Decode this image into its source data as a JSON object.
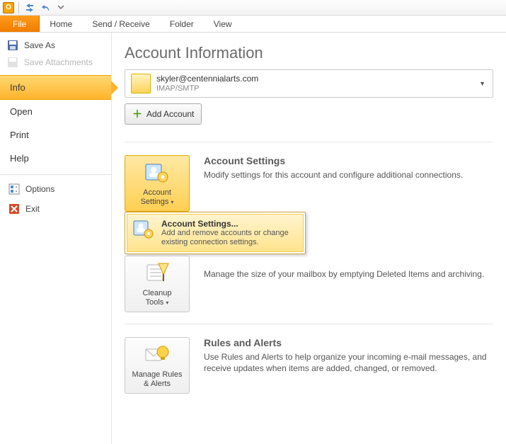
{
  "ribbon": {
    "file": "File",
    "tabs": [
      "Home",
      "Send / Receive",
      "Folder",
      "View"
    ]
  },
  "nav": {
    "save_as": "Save As",
    "save_attachments": "Save Attachments",
    "items": [
      "Info",
      "Open",
      "Print",
      "Help"
    ],
    "selected_index": 0,
    "options": "Options",
    "exit": "Exit"
  },
  "page": {
    "title": "Account Information",
    "account": {
      "email": "skyler@centennialarts.com",
      "protocol": "IMAP/SMTP"
    },
    "add_account": "Add Account",
    "sections": {
      "account_settings": {
        "button_line1": "Account",
        "button_line2": "Settings",
        "heading": "Account Settings",
        "body": "Modify settings for this account and configure additional connections.",
        "menu": {
          "title": "Account Settings...",
          "desc": "Add and remove accounts or change existing connection settings."
        }
      },
      "cleanup": {
        "button_line1": "Cleanup",
        "button_line2": "Tools",
        "body": "Manage the size of your mailbox by emptying Deleted Items and archiving."
      },
      "rules": {
        "button_line1": "Manage Rules",
        "button_line2": "& Alerts",
        "heading": "Rules and Alerts",
        "body": "Use Rules and Alerts to help organize your incoming e-mail messages, and receive updates when items are added, changed, or removed."
      }
    }
  }
}
